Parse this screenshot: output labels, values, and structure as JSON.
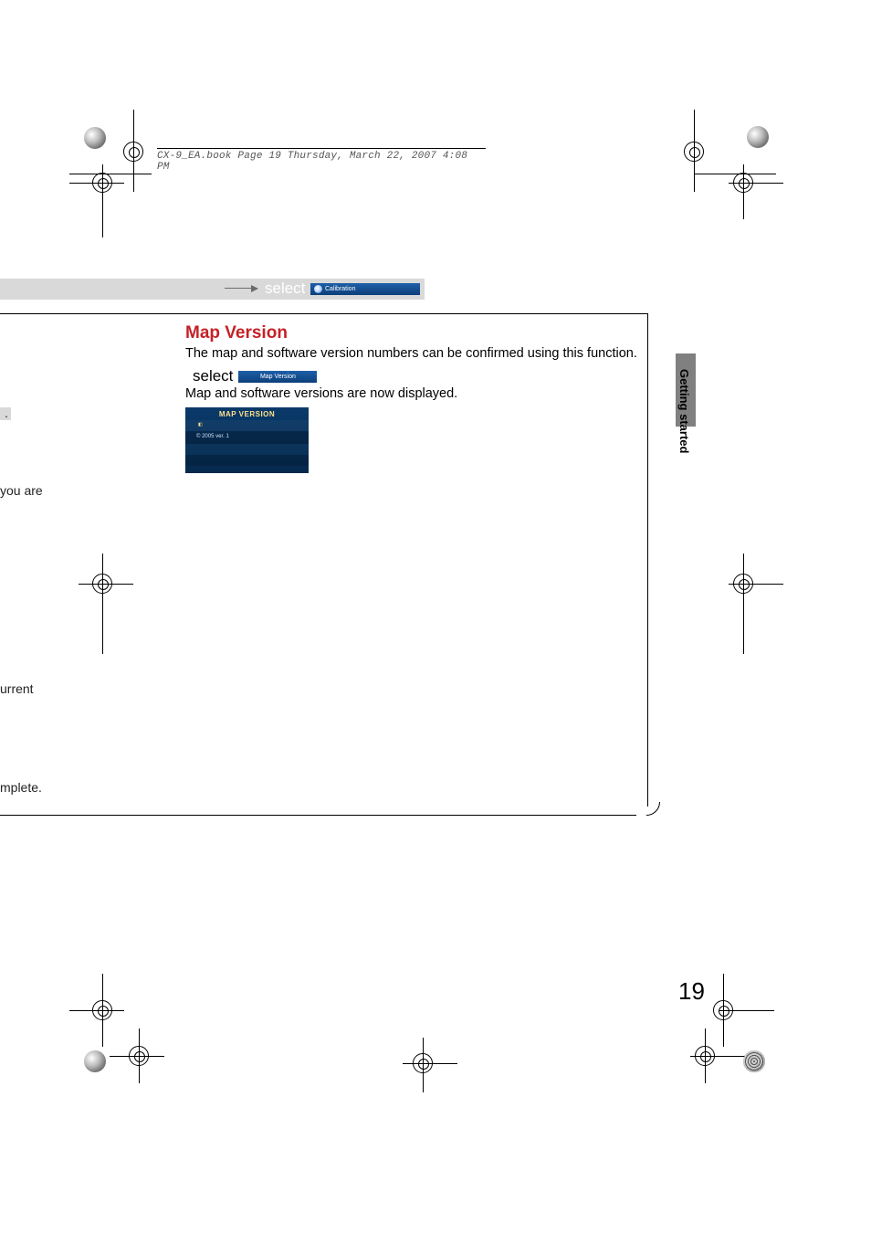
{
  "running_head": "CX-9_EA.book  Page 19  Thursday, March 22, 2007  4:08 PM",
  "band": {
    "select_label": "select",
    "chip_icon_name": "home-circle-icon",
    "chip_text": "Calibration"
  },
  "content": {
    "heading": "Map Version",
    "intro": "The map and software version numbers can be confirmed using this function.",
    "select2_label": "select",
    "select2_chip": "Map Version",
    "line2": "Map and software versions are now displayed.",
    "screen": {
      "title": "MAP VERSION",
      "tiny_row_icon_desc": "dvd-icon",
      "info_line": "© 2005 ver. 1"
    }
  },
  "side": {
    "section_label": "Getting started"
  },
  "peek": {
    "p2": "you are",
    "p3": "urrent",
    "p4": "mplete."
  },
  "page_number": "19"
}
